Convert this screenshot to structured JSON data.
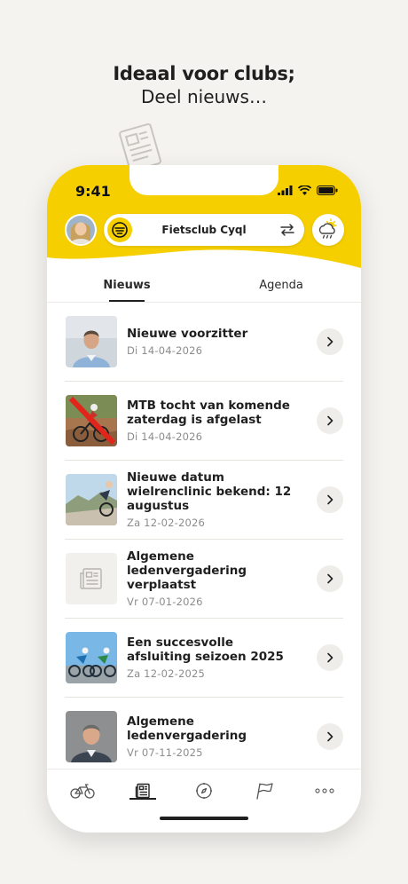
{
  "headline": {
    "line1": "Ideaal voor clubs;",
    "line2": "Deel nieuws…"
  },
  "status_bar": {
    "time": "9:41"
  },
  "header": {
    "club_name": "Fietsclub Cyql",
    "brand_color": "#f6cf00"
  },
  "tabs": [
    {
      "label": "Nieuws",
      "active": true
    },
    {
      "label": "Agenda",
      "active": false
    }
  ],
  "news": [
    {
      "title": "Nieuwe voorzitter",
      "date": "Di  14-04-2026",
      "thumb": "person-photo"
    },
    {
      "title": "MTB tocht van komende zaterdag is afgelast",
      "date": "Di  14-04-2026",
      "thumb": "mtb-photo"
    },
    {
      "title": "Nieuwe datum wielrenclinic bekend: 12 augustus",
      "date": "Za  12-02-2026",
      "thumb": "road-photo"
    },
    {
      "title": "Algemene ledenvergadering verplaatst",
      "date": "Vr  07-01-2026",
      "thumb": "newspaper-placeholder"
    },
    {
      "title": "Een succesvolle afsluiting seizoen 2025",
      "date": "Za  12-02-2025",
      "thumb": "race-photo"
    },
    {
      "title": "Algemene ledenvergadering",
      "date": "Vr  07-11-2025",
      "thumb": "person-photo"
    }
  ],
  "bottom_nav": [
    {
      "icon": "bicycle-icon"
    },
    {
      "icon": "newspaper-icon",
      "active": true
    },
    {
      "icon": "compass-icon"
    },
    {
      "icon": "flag-icon"
    },
    {
      "icon": "more-icon"
    }
  ]
}
